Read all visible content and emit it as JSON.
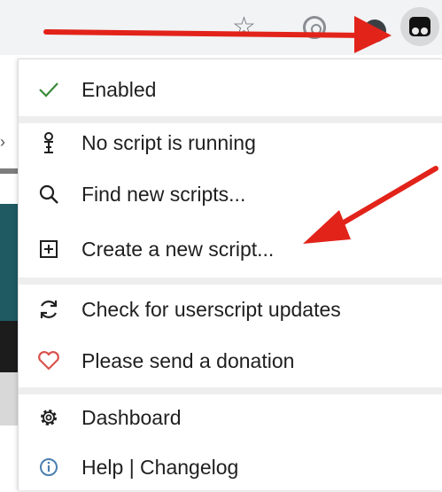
{
  "toolbar": {
    "icons": [
      "star-icon",
      "extension-icon",
      "extension-icon",
      "tampermonkey-icon"
    ]
  },
  "menu": {
    "items": [
      {
        "label": "Enabled",
        "icon": "checkmark-icon"
      },
      {
        "label": "No script is running",
        "icon": "script-status-icon"
      },
      {
        "label": "Find new scripts...",
        "icon": "search-icon"
      },
      {
        "label": "Create a new script...",
        "icon": "add-box-icon"
      },
      {
        "label": "Check for userscript updates",
        "icon": "refresh-icon"
      },
      {
        "label": "Please send a donation",
        "icon": "heart-icon"
      },
      {
        "label": "Dashboard",
        "icon": "gear-icon"
      },
      {
        "label": "Help | Changelog",
        "icon": "info-icon"
      }
    ]
  },
  "colors": {
    "arrow": "#e2231a",
    "check": "#3a8a3a",
    "heart": "#d9534f",
    "info": "#4a7fb0"
  }
}
